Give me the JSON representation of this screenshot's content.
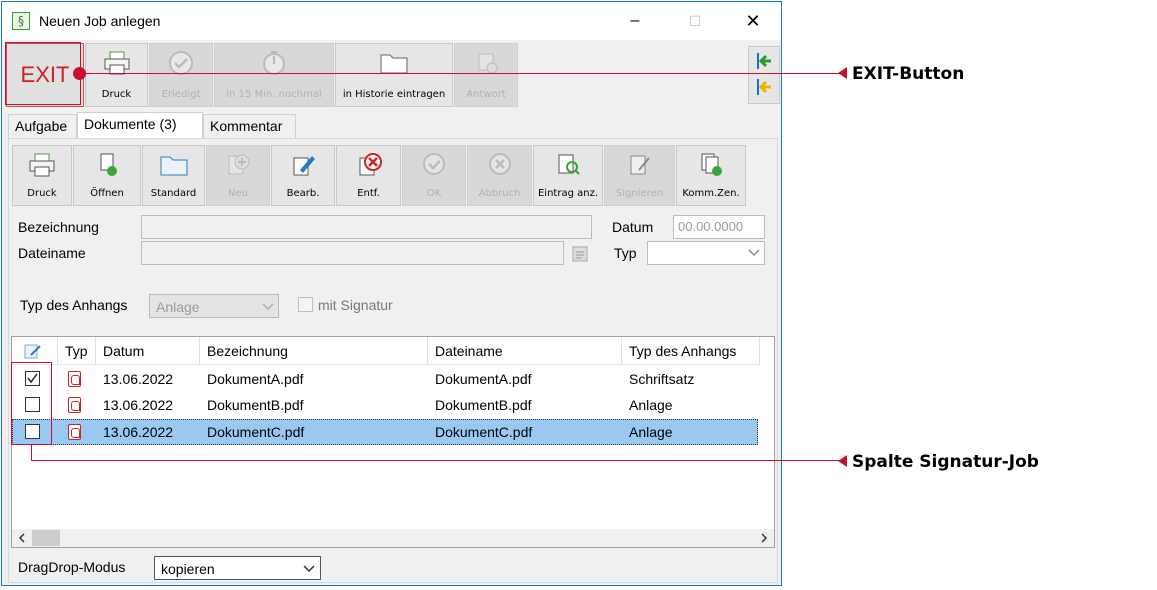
{
  "window": {
    "title": "Neuen Job anlegen",
    "controls": {
      "minimize": "–",
      "maximize": "☐",
      "close": "✕"
    }
  },
  "toolbar": {
    "exit_label": "EXIT",
    "buttons": [
      {
        "label": "Druck",
        "icon": "printer-icon",
        "enabled": true
      },
      {
        "label": "Erledigt",
        "icon": "checkmark-icon",
        "enabled": false
      },
      {
        "label": "in 15 Min. nochmal",
        "icon": "timer-icon",
        "enabled": false
      },
      {
        "label": "in Historie eintragen",
        "icon": "folder-icon",
        "enabled": true
      },
      {
        "label": "Antwort",
        "icon": "reply-icon",
        "enabled": false
      }
    ],
    "side_arrows": [
      "arrow-left-icon",
      "arrow-left-yellow-icon"
    ]
  },
  "tabs": [
    {
      "label": "Aufgabe",
      "active": false
    },
    {
      "label": "Dokumente (3)",
      "active": true
    },
    {
      "label": "Kommentar",
      "active": false
    }
  ],
  "doc_toolbar": {
    "buttons": [
      {
        "label": "Druck",
        "icon": "printer-icon",
        "enabled": true
      },
      {
        "label": "Öffnen",
        "icon": "open-document-icon",
        "enabled": true
      },
      {
        "label": "Standard",
        "icon": "folder-icon",
        "enabled": true
      },
      {
        "label": "Neu",
        "icon": "add-icon",
        "enabled": false
      },
      {
        "label": "Bearb.",
        "icon": "edit-pencil-icon",
        "enabled": true
      },
      {
        "label": "Entf.",
        "icon": "delete-icon",
        "enabled": true
      },
      {
        "label": "OK",
        "icon": "checkmark-icon",
        "enabled": false
      },
      {
        "label": "Abbruch",
        "icon": "cancel-icon",
        "enabled": false
      },
      {
        "label": "Eintrag anz.",
        "icon": "view-entry-icon",
        "enabled": true
      },
      {
        "label": "Signieren",
        "icon": "sign-icon",
        "enabled": false
      },
      {
        "label": "Komm.Zen.",
        "icon": "communication-center-icon",
        "enabled": true
      }
    ]
  },
  "form": {
    "bezeichnung_label": "Bezeichnung",
    "dateiname_label": "Dateiname",
    "datum_label": "Datum",
    "datum_value": "00.00.0000",
    "typ_label": "Typ",
    "typ_anhang_label": "Typ des Anhangs",
    "typ_anhang_value": "Anlage",
    "signatur_label": "mit Signatur"
  },
  "grid": {
    "columns": [
      "",
      "Typ",
      "Datum",
      "Bezeichnung",
      "Dateiname",
      "Typ des Anhangs"
    ],
    "rows": [
      {
        "checked": true,
        "date": "13.06.2022",
        "bezeichnung": "DokumentA.pdf",
        "dateiname": "DokumentA.pdf",
        "typ_anhang": "Schriftsatz",
        "selected": false
      },
      {
        "checked": false,
        "date": "13.06.2022",
        "bezeichnung": "DokumentB.pdf",
        "dateiname": "DokumentB.pdf",
        "typ_anhang": "Anlage",
        "selected": false
      },
      {
        "checked": false,
        "date": "13.06.2022",
        "bezeichnung": "DokumentC.pdf",
        "dateiname": "DokumentC.pdf",
        "typ_anhang": "Anlage",
        "selected": true
      }
    ]
  },
  "footer": {
    "dragdrop_label": "DragDrop-Modus",
    "dragdrop_value": "kopieren"
  },
  "annotations": {
    "exit": "EXIT-Button",
    "signatur": "Spalte Signatur-Job"
  },
  "colors": {
    "accent_red": "#c8102e",
    "selection": "#99c9f2",
    "window_border": "#1979ca"
  }
}
